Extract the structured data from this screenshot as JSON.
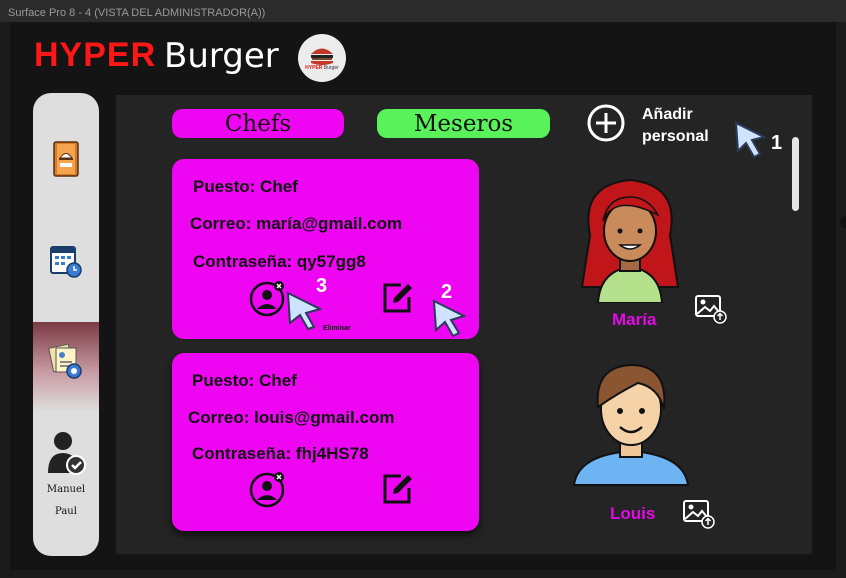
{
  "window": {
    "title": "Surface Pro 8 - 4 (VISTA DEL ADMINISTRADOR(A))"
  },
  "brand": {
    "hyper": "HYPER",
    "burger": "Burger",
    "logo_text_hyper": "HYPER",
    "logo_text_burger": "Burger"
  },
  "sidebar": {
    "items": [
      {
        "icon": "menu-book-icon"
      },
      {
        "icon": "calendar-clock-icon"
      },
      {
        "icon": "staff-documents-icon",
        "active": true
      },
      {
        "icon": "user-check-icon"
      }
    ],
    "user_first": "Manuel",
    "user_last": "Paul"
  },
  "tabs": [
    {
      "label": "Chefs",
      "color": "#ee06f2"
    },
    {
      "label": "Meseros",
      "color": "#59f25b"
    }
  ],
  "add_staff": {
    "line1": "Añadir",
    "line2": "personal"
  },
  "staff": [
    {
      "puesto": "Puesto: Chef",
      "correo": "Correo: maría@gmail.com",
      "contrasena": "Contraseña: qy57gg8",
      "name": "María"
    },
    {
      "puesto": "Puesto: Chef",
      "correo": "Correo: louis@gmail.com",
      "contrasena": "Contraseña: fhj4HS78",
      "name": "Louis"
    }
  ],
  "tooltip_delete": "Eliminar",
  "annotations": {
    "n1": "1",
    "n2": "2",
    "n3": "3"
  },
  "colors": {
    "accent_magenta": "#ee06f2",
    "accent_green": "#59f25b",
    "brand_red": "#ff1616",
    "name_magenta": "#e30ae6"
  }
}
